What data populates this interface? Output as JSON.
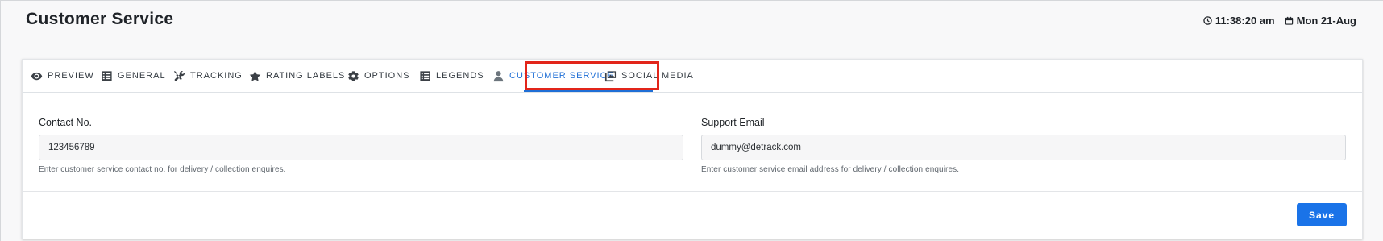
{
  "header": {
    "title": "Customer Service",
    "time": "11:38:20 am",
    "date": "Mon 21-Aug"
  },
  "tabs": [
    {
      "label": "PREVIEW",
      "icon": "eye-icon"
    },
    {
      "label": "GENERAL",
      "icon": "list-icon"
    },
    {
      "label": "TRACKING",
      "icon": "tools-icon"
    },
    {
      "label": "RATING LABELS",
      "icon": "star-icon"
    },
    {
      "label": "OPTIONS",
      "icon": "gear-icon"
    },
    {
      "label": "LEGENDS",
      "icon": "list-icon"
    },
    {
      "label": "CUSTOMER SERVICE",
      "icon": "user-icon",
      "active": true
    },
    {
      "label": "SOCIAL MEDIA",
      "icon": "images-icon"
    }
  ],
  "form": {
    "contact": {
      "label": "Contact No.",
      "value": "123456789",
      "help": "Enter customer service contact no. for delivery / collection enquires."
    },
    "email": {
      "label": "Support Email",
      "value": "dummy@detrack.com",
      "help": "Enter customer service email address for delivery / collection enquires."
    }
  },
  "footer": {
    "save_label": "Save"
  },
  "colors": {
    "accent": "#1a73e8",
    "highlight": "#e2251a"
  }
}
